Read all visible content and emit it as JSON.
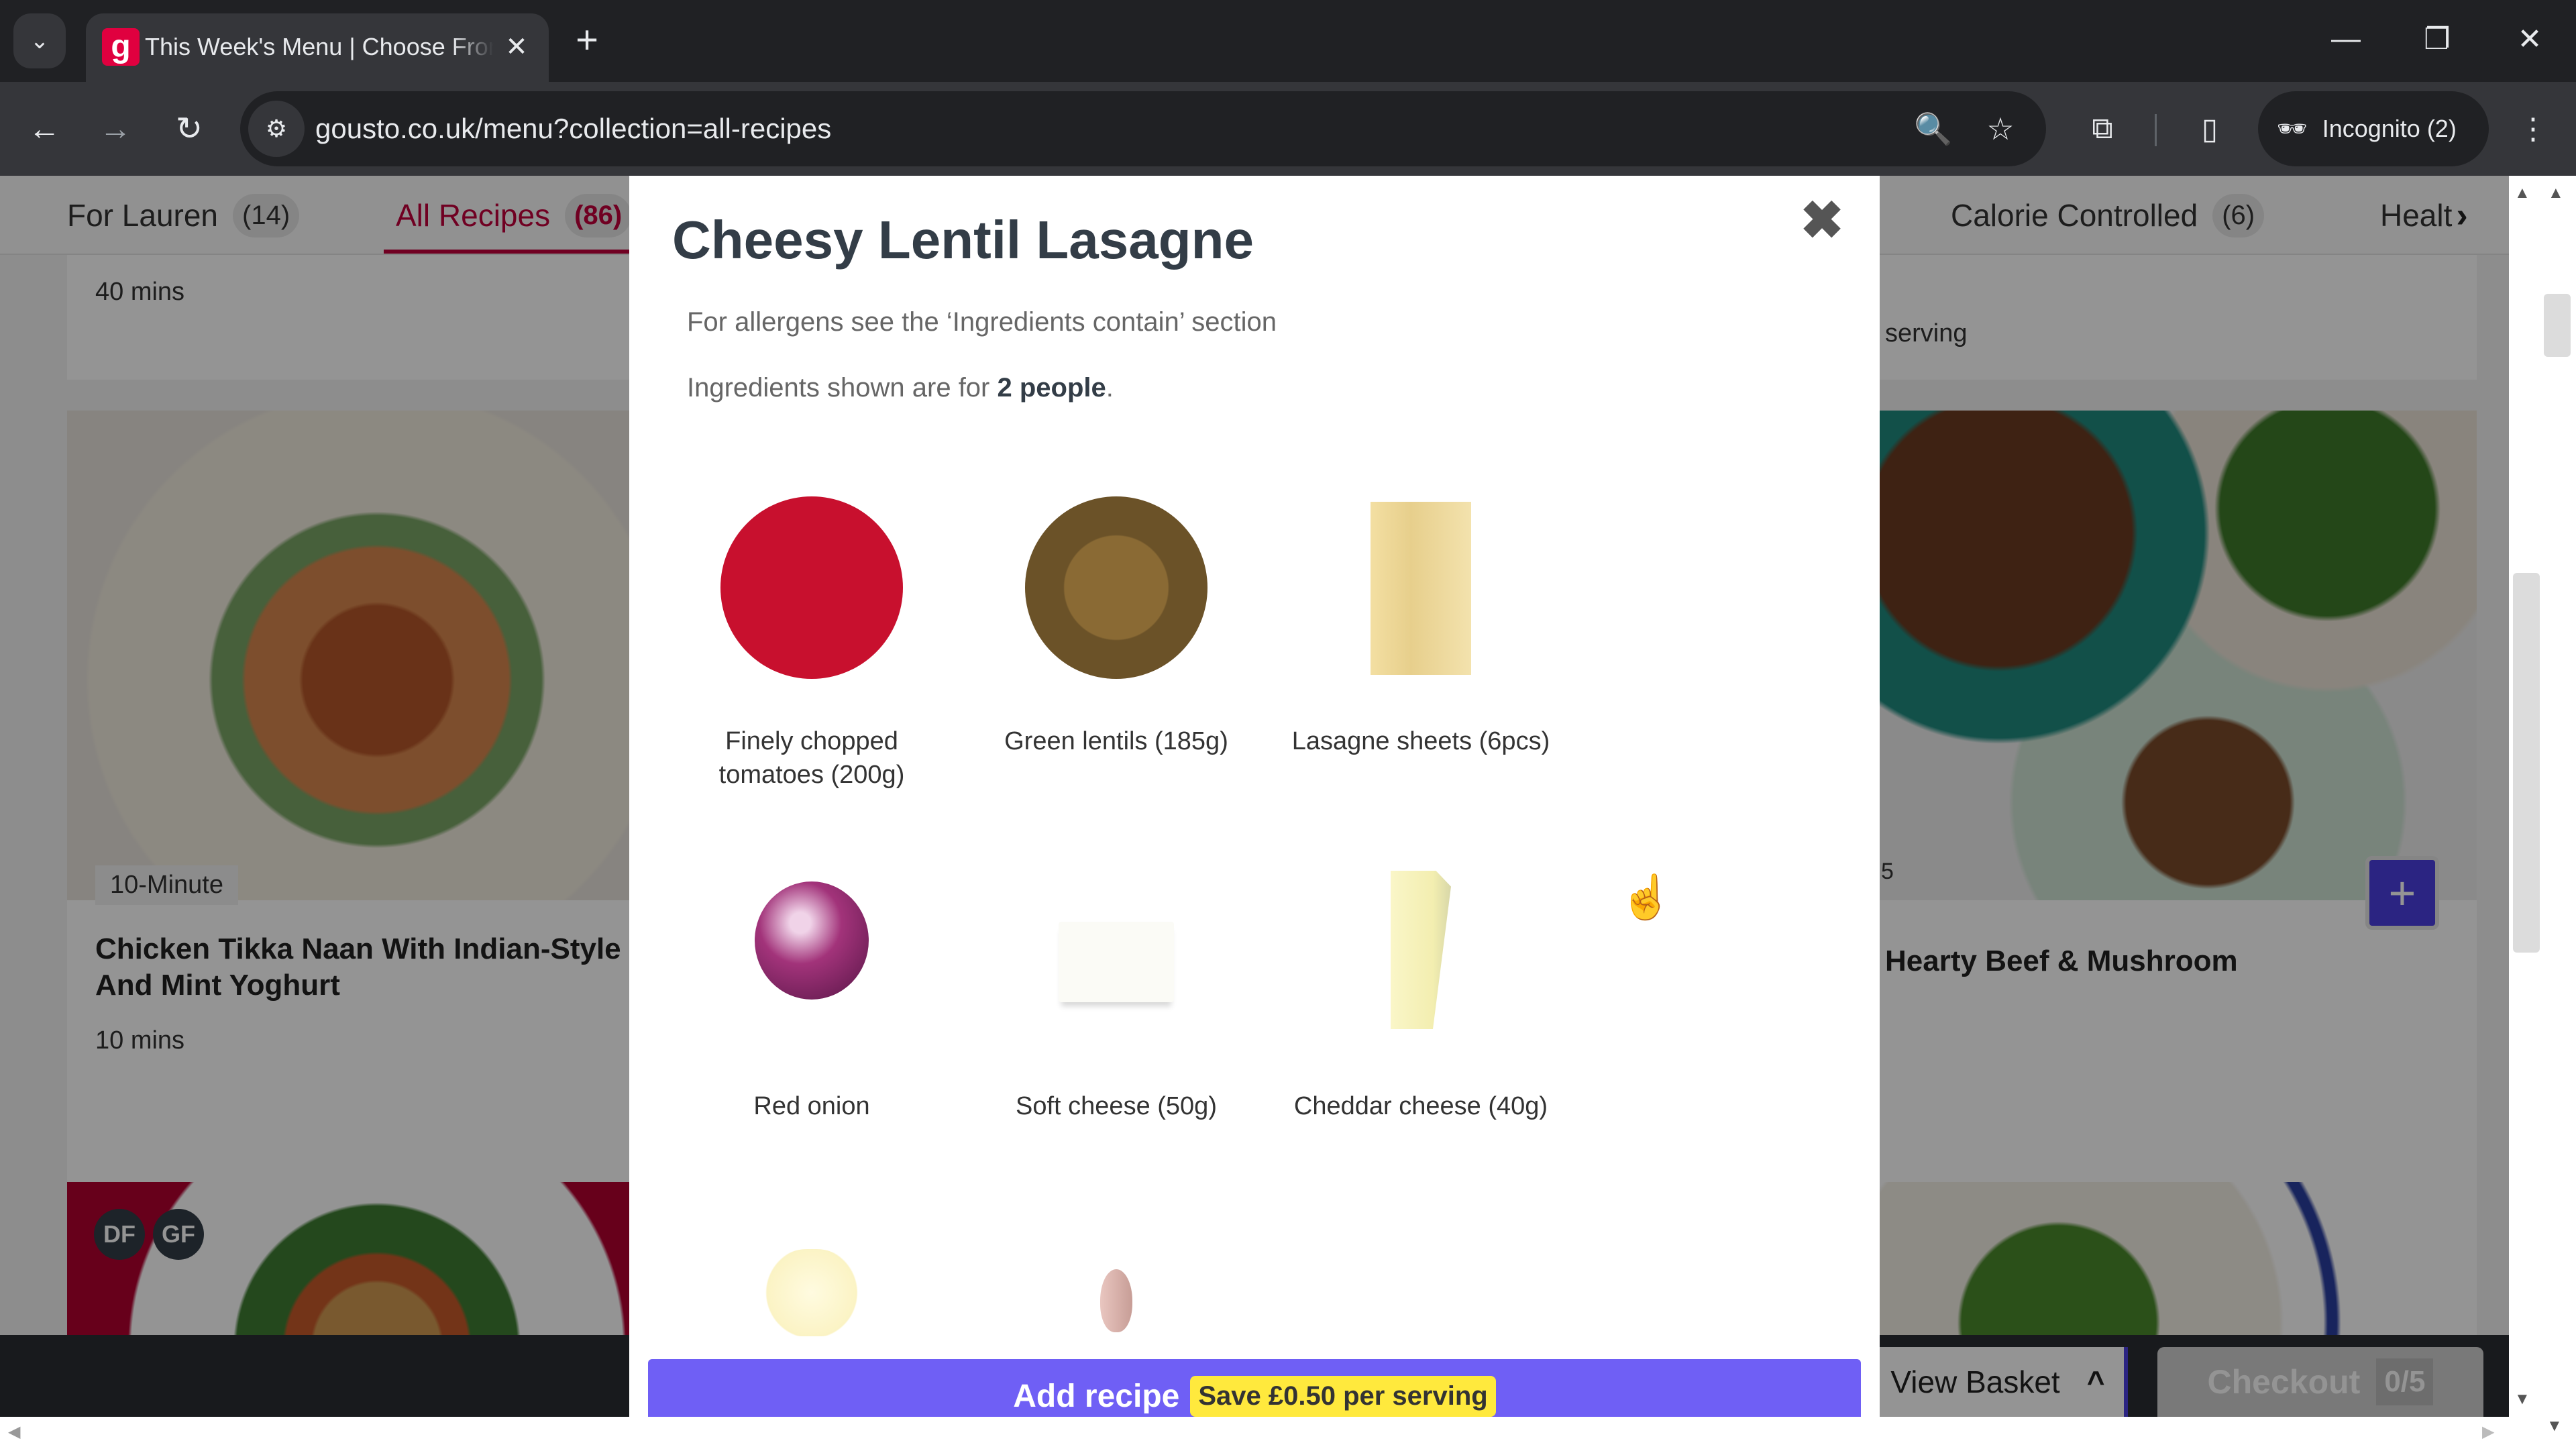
{
  "browser": {
    "tab_title": "This Week's Menu | Choose From",
    "tab_favicon_letter": "g",
    "url": "gousto.co.uk/menu?collection=all-recipes",
    "incognito_label": "Incognito (2)",
    "icons": {
      "tab_list": "⌄",
      "close_tab": "✕",
      "new_tab": "+",
      "minimize": "—",
      "restore": "❐",
      "close_window": "✕",
      "back": "←",
      "forward": "→",
      "reload": "↻",
      "site_info": "⚙",
      "zoom": "🔍",
      "bookmark": "☆",
      "extensions": "⧉",
      "side_panel": "▯",
      "incognito": "🕶",
      "menu": "⋮"
    }
  },
  "categories": [
    {
      "label": "For Lauren",
      "count": "(14)",
      "active": false
    },
    {
      "label": "All Recipes",
      "count": "(86)",
      "active": true
    },
    {
      "label": "Calorie Controlled",
      "count": "(6)",
      "active": false
    },
    {
      "label": "Healt",
      "count": "",
      "active": false
    }
  ],
  "category_more_icon": "›",
  "background_cards": {
    "top_left_time": "40 mins",
    "top_right_text": "serving",
    "mid_left": {
      "tag": "10-Minute",
      "title": "Chicken Tikka Naan With Indian-Style Salad And Mint Yoghurt",
      "time": "10 mins"
    },
    "mid_right": {
      "tag_partial": "5",
      "title": "Hearty Beef & Mushroom",
      "add_icon": "+"
    },
    "bottom_left_badges": [
      "DF",
      "GF"
    ]
  },
  "basket": {
    "view_basket_label": "View Basket",
    "view_basket_icon": "^",
    "checkout_label": "Checkout",
    "checkout_count": "0/5"
  },
  "modal": {
    "title": "Cheesy Lentil Lasagne",
    "close_icon": "✖",
    "allergen_note": "For allergens see the ‘Ingredients contain’ section",
    "servings_note_prefix": "Ingredients shown are for ",
    "servings_note_bold": "2 people",
    "servings_note_suffix": ".",
    "ingredients": [
      {
        "name": "Finely chopped tomatoes (200g)",
        "icon": "tomato-bowl"
      },
      {
        "name": "Green lentils (185g)",
        "icon": "lentil-bowl"
      },
      {
        "name": "Lasagne sheets (6pcs)",
        "icon": "lasagne-sheets"
      },
      {
        "name": "Red onion",
        "icon": "red-onion"
      },
      {
        "name": "Soft cheese (50g)",
        "icon": "soft-cheese"
      },
      {
        "name": "Cheddar cheese (40g)",
        "icon": "cheddar-cheese"
      },
      {
        "name": "",
        "icon": "garlic"
      },
      {
        "name": "",
        "icon": "shallot"
      }
    ],
    "add_recipe_label": "Add recipe",
    "save_badge": "Save £0.50 per serving"
  },
  "colors": {
    "brand_red": "#c2003c",
    "cta_purple": "#6f5ff5",
    "add_button": "#4b3fe0",
    "save_yellow": "#ffe93d"
  }
}
